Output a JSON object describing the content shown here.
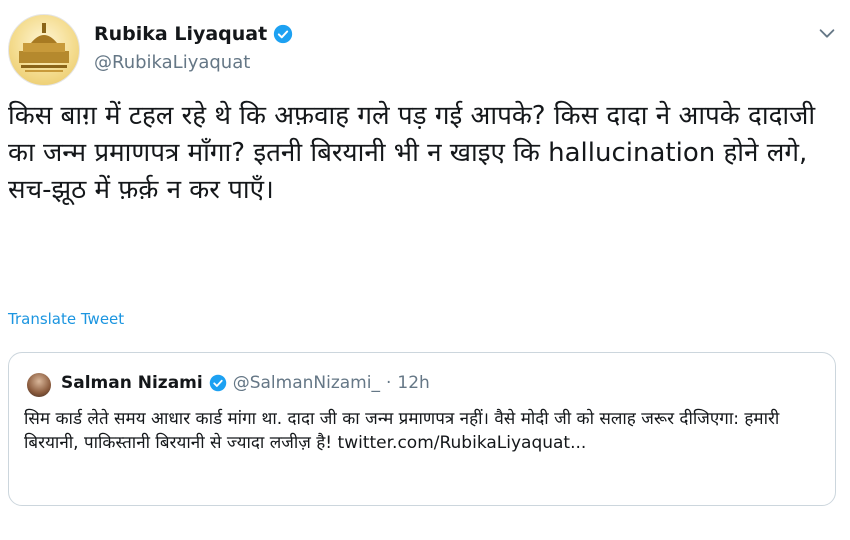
{
  "author": {
    "display_name": "Rubika Liyaquat",
    "handle": "@RubikaLiyaquat",
    "verified_icon": "verified-badge-icon",
    "accent_color": "#1da1f2"
  },
  "tweet": {
    "text": "किस बाग़ में टहल रहे थे कि अफ़वाह गले पड़ गई आपके? किस दादा ने आपके दादाजी का जन्म प्रमाणपत्र माँगा? इतनी बिरयानी भी न खाइए कि hallucination होने लगे, सच-झूठ में फ़र्क़ न कर पाएँ।",
    "translate_label": "Translate Tweet"
  },
  "quoted": {
    "display_name": "Salman Nizami",
    "handle": "@SalmanNizami_",
    "separator": "·",
    "time": "12h",
    "text": "सिम कार्ड लेते समय आधार कार्ड मांगा था. दादा जी का जन्म प्रमाणपत्र नहीं। वैसे मोदी जी को सलाह जरूर दीजिएगा: हमारी बिरयानी, पाकिस्तानी बिरयानी से ज्यादा लजीज़ है! twitter.com/RubikaLiyaquat..."
  },
  "icons": {
    "more": "chevron-down-icon",
    "verified": "verified-badge-icon"
  }
}
